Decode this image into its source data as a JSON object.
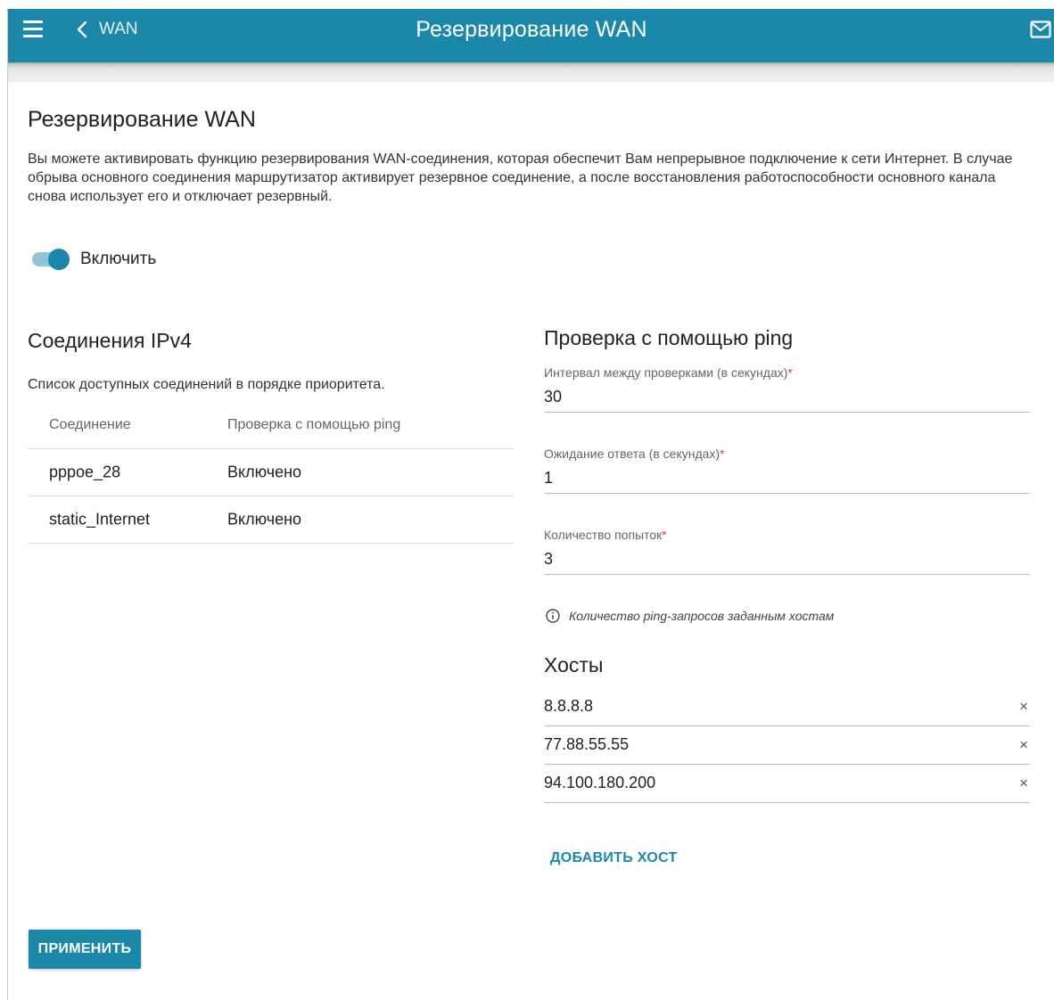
{
  "header": {
    "back_label": "WAN",
    "title": "Резервирование WAN"
  },
  "page": {
    "title": "Резервирование WAN",
    "intro": "Вы можете активировать функцию резервирования WAN-соединения, которая обеспечит Вам непрерывное подключение к сети Интернет. В случае обрыва основного соединения маршрутизатор активирует резервное соединение, а после восстановления работоспособности основного канала снова использует его и отключает резервный.",
    "enable_label": "Включить",
    "enable_on": true
  },
  "connections": {
    "title": "Соединения IPv4",
    "subtitle": "Список доступных соединений в порядке приоритета.",
    "columns": [
      "Соединение",
      "Проверка с помощью ping"
    ],
    "rows": [
      [
        "pppoe_28",
        "Включено"
      ],
      [
        "static_Internet",
        "Включено"
      ]
    ]
  },
  "ping": {
    "title": "Проверка с помощью ping",
    "interval_label": "Интервал между проверками (в секундах)",
    "interval_value": "30",
    "timeout_label": "Ожидание ответа (в секундах)",
    "timeout_value": "1",
    "attempts_label": "Количество попыток",
    "attempts_value": "3",
    "required_mark": "*",
    "info": "Количество ping-запросов заданным хостам"
  },
  "hosts": {
    "title": "Хосты",
    "items": [
      "8.8.8.8",
      "77.88.55.55",
      "94.100.180.200"
    ],
    "remove_symbol": "×",
    "add_label": "ДОБАВИТЬ ХОСТ"
  },
  "apply_label": "ПРИМЕНИТЬ",
  "colors": {
    "accent": "#1b87a9",
    "required": "#e53935"
  }
}
